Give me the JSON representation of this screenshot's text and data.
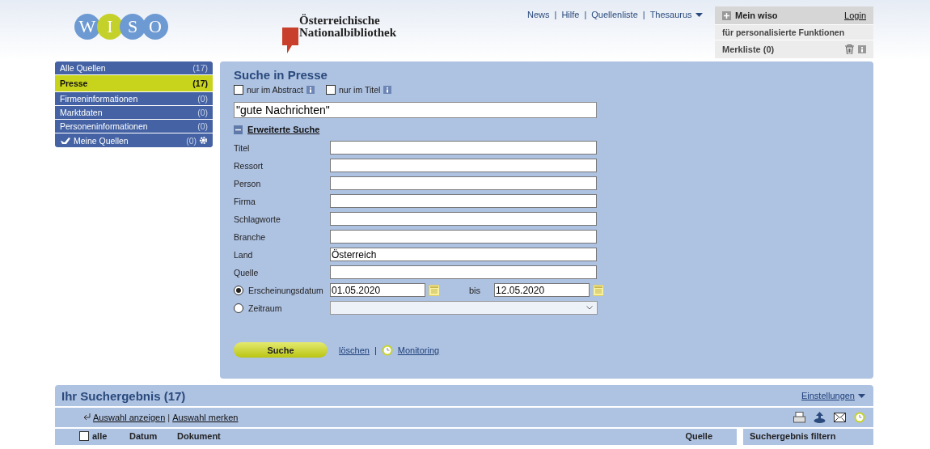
{
  "header": {
    "logo_letters": [
      "W",
      "I",
      "S",
      "O"
    ],
    "partner_line1": "Österreichische",
    "partner_line2": "Nationalbibliothek",
    "separator": "|",
    "top_links": [
      {
        "label": "News",
        "dropdown": false
      },
      {
        "label": "Hilfe",
        "dropdown": false
      },
      {
        "label": "Quellenliste",
        "dropdown": false
      },
      {
        "label": "Thesaurus",
        "dropdown": true
      }
    ],
    "mein_wiso": {
      "title": "Mein wiso",
      "login": "Login",
      "hint": "für personalisierte Funktionen",
      "merkliste": "Merkliste (0)"
    }
  },
  "sidebar": {
    "items": [
      {
        "label": "Alle Quellen",
        "count": "(17)",
        "selected": false,
        "kind": "source"
      },
      {
        "label": "Presse",
        "count": "(17)",
        "selected": true,
        "kind": "source"
      },
      {
        "label": "Firmeninformationen",
        "count": "(0)",
        "selected": false,
        "kind": "source"
      },
      {
        "label": "Marktdaten",
        "count": "(0)",
        "selected": false,
        "kind": "source"
      },
      {
        "label": "Personeninformationen",
        "count": "(0)",
        "selected": false,
        "kind": "source"
      },
      {
        "label": "Meine Quellen",
        "count": "(0)",
        "selected": false,
        "kind": "custom"
      }
    ]
  },
  "search": {
    "title": "Suche in Presse",
    "options": [
      {
        "label": "nur im Abstract",
        "checked": false
      },
      {
        "label": "nur im Titel",
        "checked": false
      }
    ],
    "query": "\"gute Nachrichten\"",
    "advanced_label": "Erweiterte Suche",
    "advanced_expanded": true,
    "fields": [
      {
        "label": "Titel"
      },
      {
        "label": "Ressort"
      },
      {
        "label": "Person"
      },
      {
        "label": "Firma"
      },
      {
        "label": "Schlagworte"
      },
      {
        "label": "Branche"
      },
      {
        "label": "Land",
        "value": "Österreich"
      },
      {
        "label": "Quelle"
      }
    ],
    "separator": "|",
    "date_modes": [
      {
        "label": "Erscheinungsdatum",
        "selected": true,
        "kind": "range",
        "from": "01.05.2020",
        "to_label": "bis",
        "to": "12.05.2020"
      },
      {
        "label": "Zeitraum",
        "selected": false,
        "kind": "select"
      }
    ],
    "submit": "Suche",
    "clear": "löschen",
    "monitoring": "Monitoring"
  },
  "results": {
    "title": "Ihr Suchergebnis (17)",
    "settings": "Einstellungen",
    "actions": [
      "Auswahl anzeigen",
      "Auswahl merken"
    ],
    "separator": "|",
    "select_all_checked": false,
    "columns": {
      "select_all": "alle",
      "date": "Datum",
      "document": "Dokument",
      "source": "Quelle"
    },
    "filter_title": "Suchergebnis filtern"
  }
}
